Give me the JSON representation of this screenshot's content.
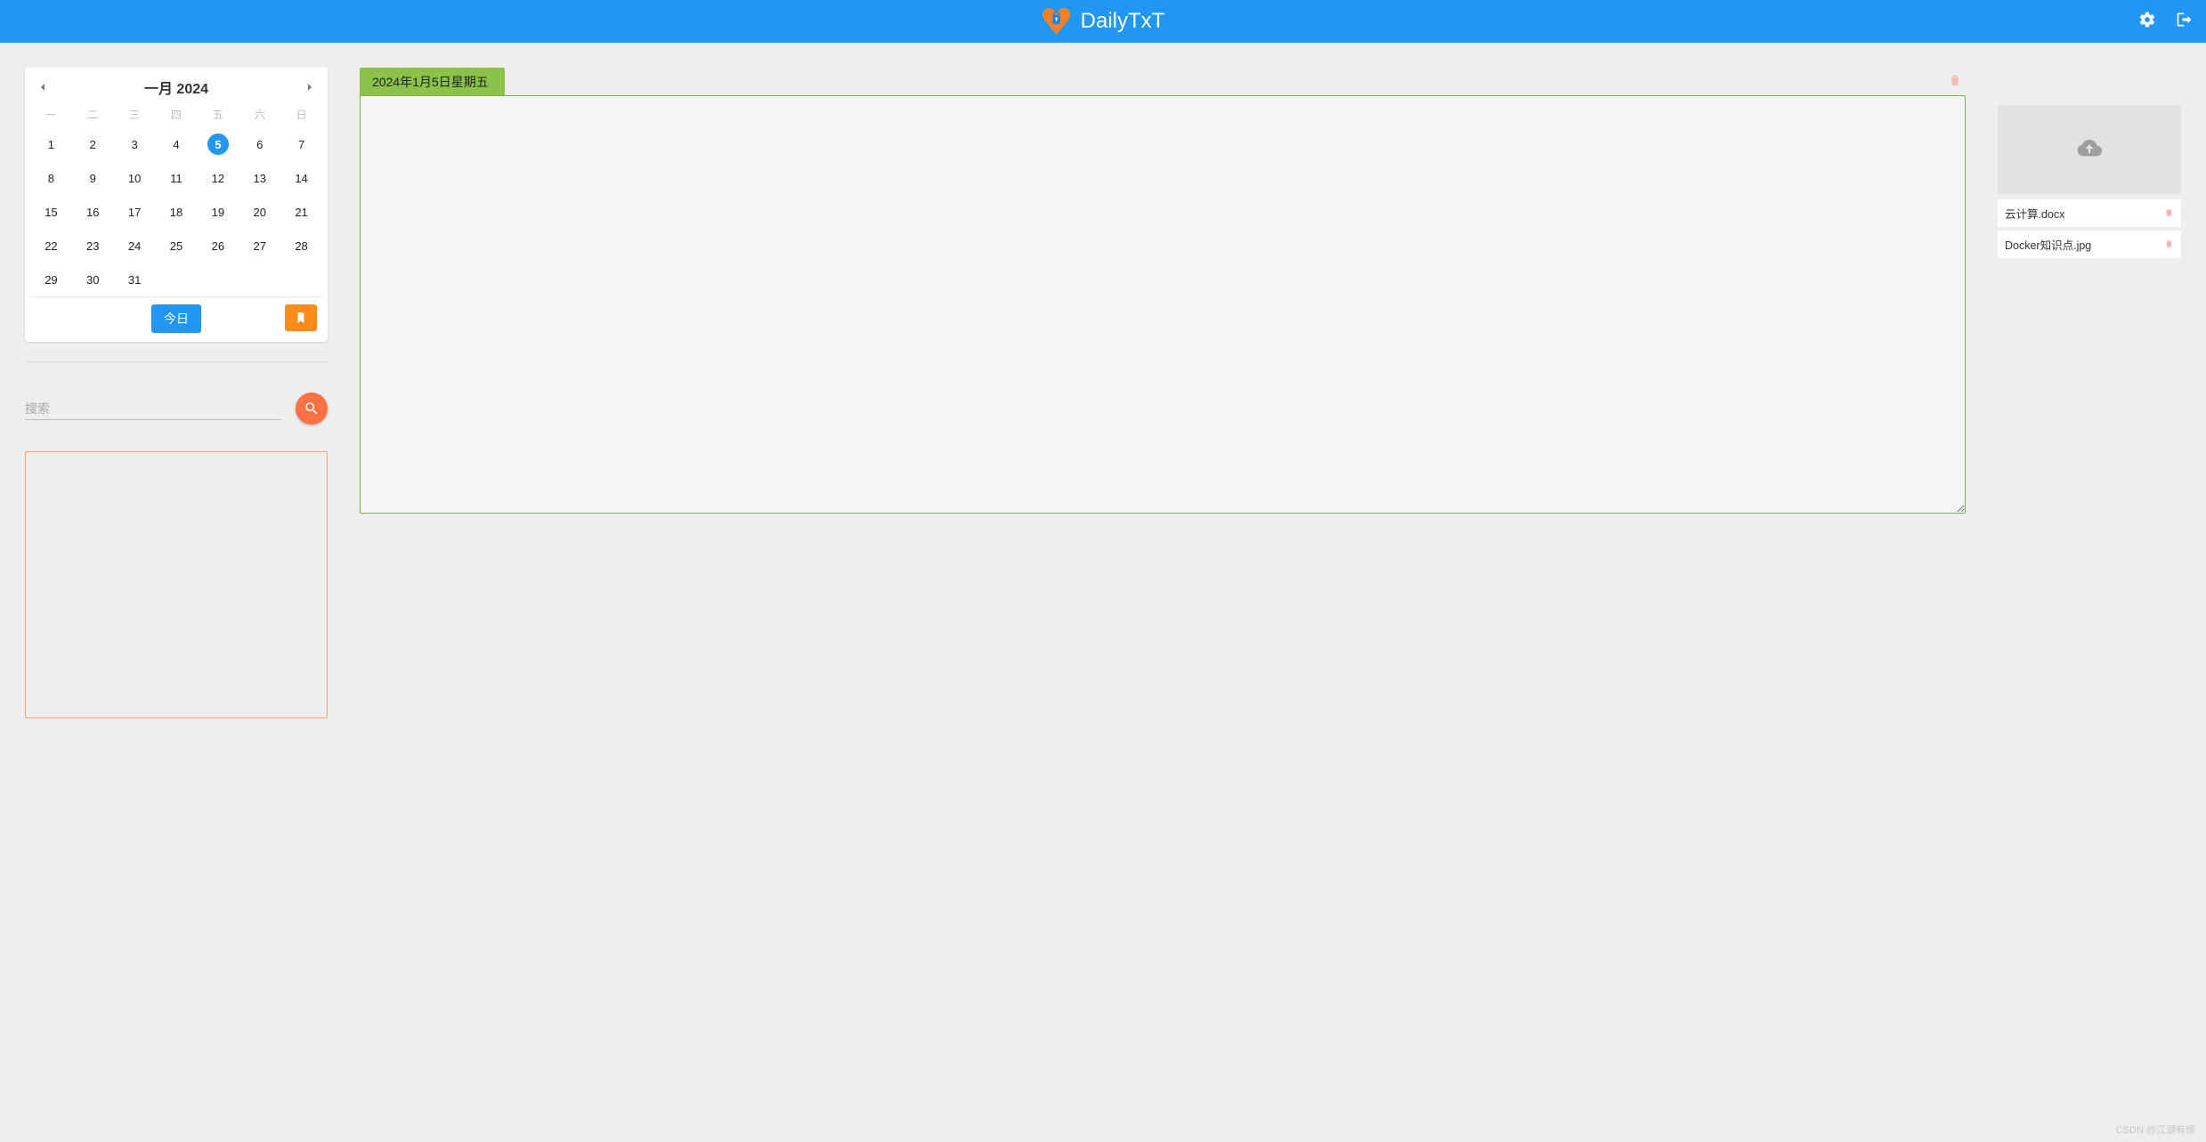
{
  "header": {
    "title": "DailyTxT",
    "icons": {
      "settings": "gear-icon",
      "logout": "logout-icon"
    }
  },
  "calendar": {
    "title": "一月 2024",
    "weekdays": [
      "一",
      "二",
      "三",
      "四",
      "五",
      "六",
      "日"
    ],
    "days": [
      1,
      2,
      3,
      4,
      5,
      6,
      7,
      8,
      9,
      10,
      11,
      12,
      13,
      14,
      15,
      16,
      17,
      18,
      19,
      20,
      21,
      22,
      23,
      24,
      25,
      26,
      27,
      28,
      29,
      30,
      31
    ],
    "selected": 5,
    "today_label": "今日"
  },
  "search": {
    "placeholder": "搜索"
  },
  "entry": {
    "date_label": "2024年1月5日星期五",
    "text": ""
  },
  "files": [
    {
      "name": "云计算.docx"
    },
    {
      "name": "Docker知识点.jpg"
    }
  ],
  "watermark": "CSDN @江湖有缘"
}
